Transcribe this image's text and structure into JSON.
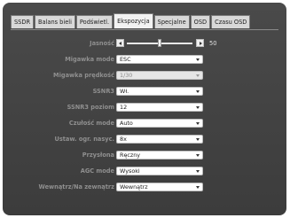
{
  "tabs": [
    "SSDR",
    "Balans bieli",
    "Podświetl.",
    "Ekspozycja",
    "Specjalne",
    "OSD",
    "Czasu OSD"
  ],
  "active_tab": "Ekspozycja",
  "brightness": {
    "label": "Jasność",
    "value": "50",
    "level": 0.5
  },
  "fields": {
    "shutter_mode": {
      "label": "Migawka mode",
      "value": "ESC"
    },
    "shutter_speed": {
      "label": "Migawka prędkość",
      "value": "1/30"
    },
    "ssnr3": {
      "label": "SSNR3",
      "value": "Wł."
    },
    "ssnr3_level": {
      "label": "SSNR3 poziom",
      "value": "12"
    },
    "sens_mode": {
      "label": "Czułość mode",
      "value": "Auto"
    },
    "max_sens": {
      "label": "Ustaw. ogr. nasyc.",
      "value": "8x"
    },
    "iris": {
      "label": "Przysłona",
      "value": "Ręczny"
    },
    "agc_mode": {
      "label": "AGC mode",
      "value": "Wysoki"
    },
    "in_out": {
      "label": "Wewnątrz/Na zewnątrz",
      "value": "Wewnątrz"
    }
  }
}
